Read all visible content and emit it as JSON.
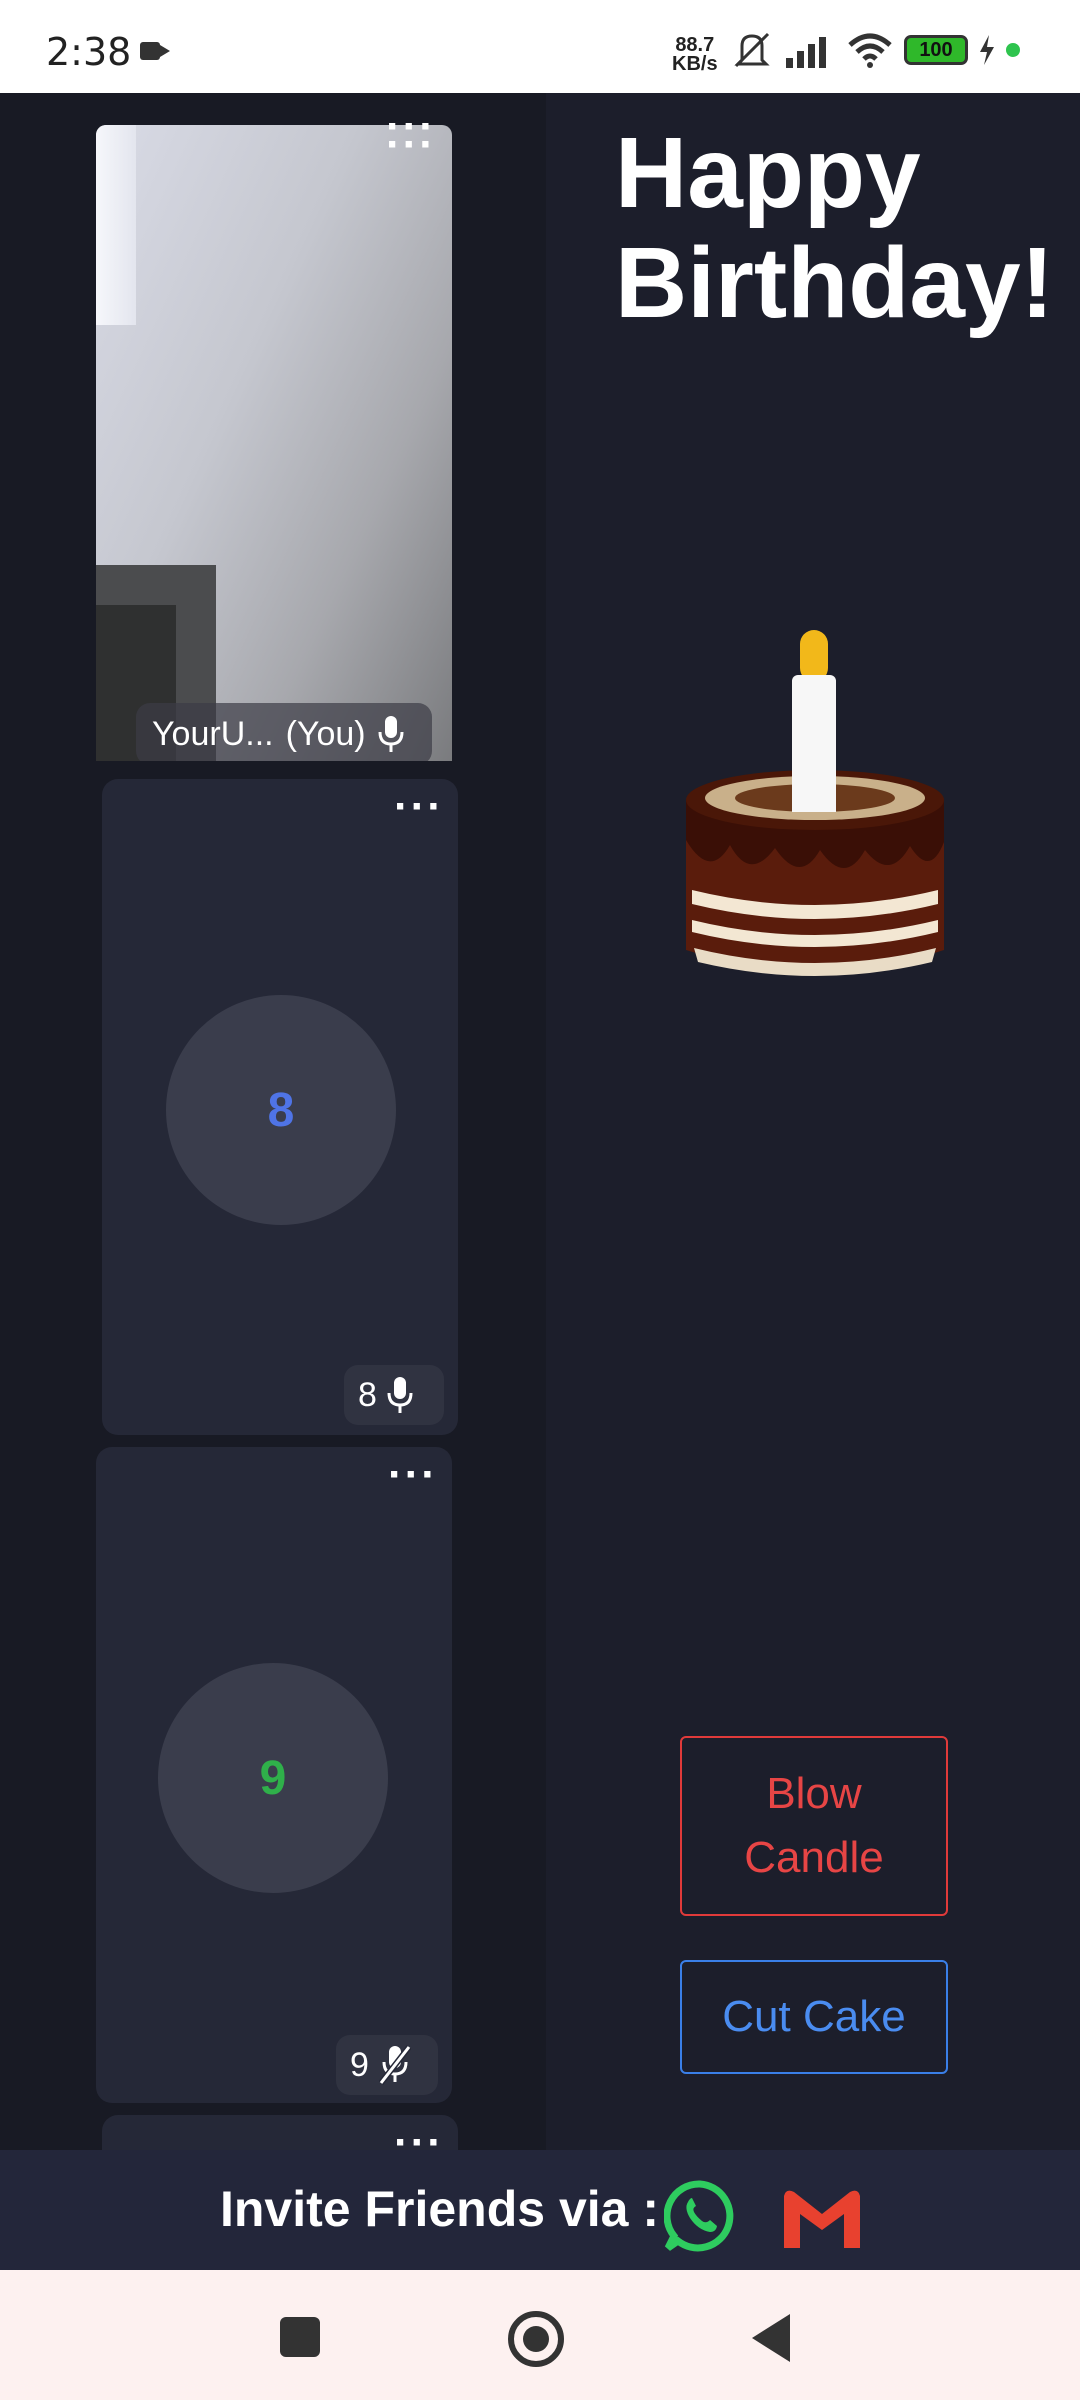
{
  "status_bar": {
    "time": "2:38",
    "net_speed_value": "88.7",
    "net_speed_unit": "KB/s",
    "battery": "100",
    "icons": [
      "video-call-icon",
      "mute-icon",
      "signal-icon",
      "wifi-icon",
      "battery-icon",
      "charging-icon",
      "privacy-dot-icon"
    ]
  },
  "participants": [
    {
      "name": "YourU...",
      "you_label": "(You)",
      "mic": "on",
      "has_video": true
    },
    {
      "avatar_text": "8",
      "avatar_color": "#4f74e6",
      "name": "8",
      "mic": "on"
    },
    {
      "avatar_text": "9",
      "avatar_color": "#2fb04a",
      "name": "9",
      "mic": "muted"
    }
  ],
  "main": {
    "title_line1": "Happy",
    "title_line2": "Birthday!",
    "blow_line1": "Blow",
    "blow_line2": "Candle",
    "cut_label": "Cut Cake",
    "blow_color": "#e03a3a",
    "cut_color": "#3a7fe8"
  },
  "invite": {
    "label": "Invite Friends via :",
    "apps": [
      "whatsapp-icon",
      "gmail-icon"
    ]
  },
  "nav": {
    "buttons": [
      "recents-button",
      "home-button",
      "back-button"
    ]
  }
}
